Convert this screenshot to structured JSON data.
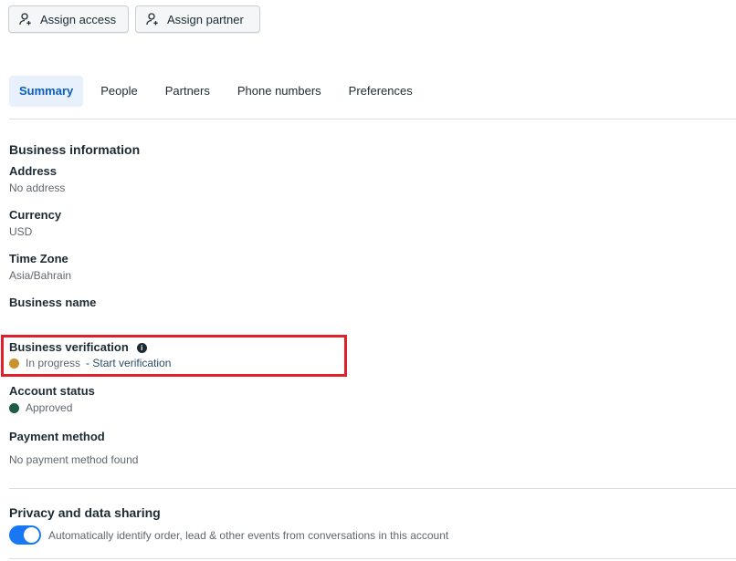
{
  "toolbar": {
    "assign_access_label": "Assign access",
    "assign_partner_label": "Assign partner"
  },
  "tabs": [
    {
      "label": "Summary",
      "active": true
    },
    {
      "label": "People",
      "active": false
    },
    {
      "label": "Partners",
      "active": false
    },
    {
      "label": "Phone numbers",
      "active": false
    },
    {
      "label": "Preferences",
      "active": false
    }
  ],
  "business_info": {
    "title": "Business information",
    "address_label": "Address",
    "address_value": "No address",
    "currency_label": "Currency",
    "currency_value": "USD",
    "timezone_label": "Time Zone",
    "timezone_value": "Asia/Bahrain",
    "name_label": "Business name",
    "verification_label": "Business verification",
    "verification_status": "In progress",
    "verification_link": "- Start verification",
    "verification_color": "#c8932e",
    "account_status_label": "Account status",
    "account_status_value": "Approved",
    "account_status_color": "#1e5a47",
    "payment_label": "Payment method",
    "payment_value": "No payment method found"
  },
  "privacy": {
    "title": "Privacy and data sharing",
    "toggle_description": "Automatically identify order, lead & other events from conversations in this account",
    "toggle_on": true
  },
  "colors": {
    "accent": "#1877f2",
    "highlight": "#e0202b"
  }
}
